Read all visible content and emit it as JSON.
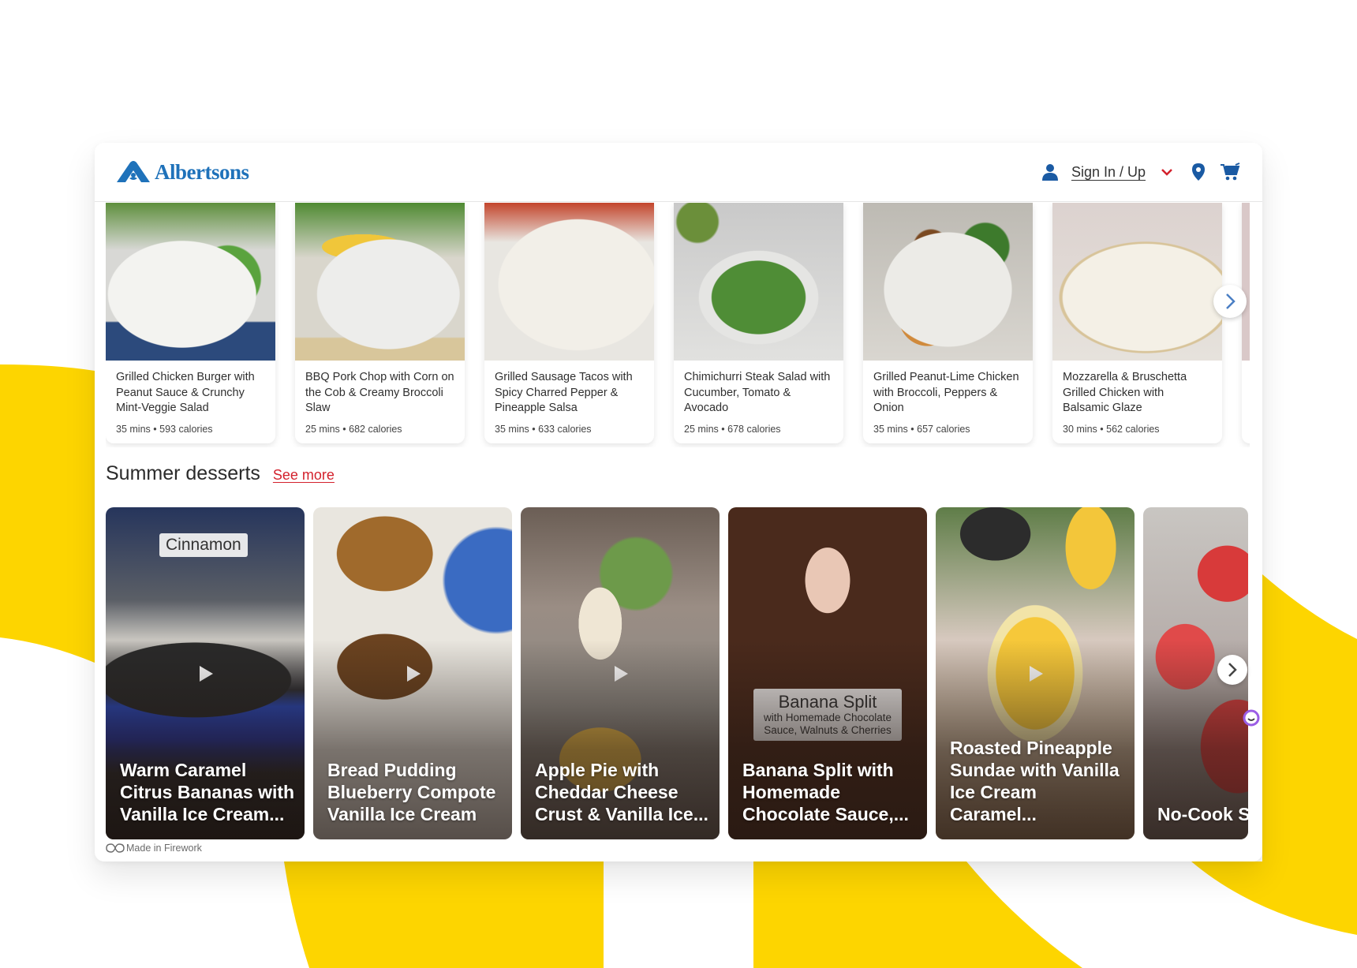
{
  "brand": {
    "name": "Albertsons",
    "primary_color": "#1f72ba",
    "accent_color": "#d3212c",
    "background_accent": "#fdd500"
  },
  "header": {
    "logo_icon": "albertsons-logo-icon",
    "user_icon": "user-icon",
    "sign_in_label": "Sign In / Up",
    "dropdown_icon": "chevron-down-icon",
    "location_icon": "location-pin-icon",
    "cart_icon": "cart-icon"
  },
  "recipes": [
    {
      "title": "Grilled Chicken Burger with Peanut Sauce & Crunchy Mint-Veggie Salad",
      "time": "35 mins",
      "calories": "593 calories"
    },
    {
      "title": "BBQ Pork Chop with Corn on the Cob & Creamy Broccoli Slaw",
      "time": "25 mins",
      "calories": "682 calories"
    },
    {
      "title": "Grilled Sausage Tacos with Spicy Charred Pepper & Pineapple Salsa",
      "time": "35 mins",
      "calories": "633 calories"
    },
    {
      "title": "Chimichurri Steak Salad with Cucumber, Tomato & Avocado",
      "time": "25 mins",
      "calories": "678 calories"
    },
    {
      "title": "Grilled Peanut-Lime Chicken with Broccoli, Peppers & Onion",
      "time": "35 mins",
      "calories": "657 calories"
    },
    {
      "title": "Mozzarella & Bruschetta Grilled Chicken with Balsamic Glaze",
      "time": "30 mins",
      "calories": "562 calories"
    }
  ],
  "meta_separator": "•",
  "desserts_section": {
    "title": "Summer desserts",
    "see_more_label": "See more",
    "videos": [
      {
        "title": "Warm Caramel Citrus Bananas with Vanilla Ice Cream...",
        "overlay": "Cinnamon"
      },
      {
        "title": "Bread Pudding Blueberry Compote Vanilla Ice Cream"
      },
      {
        "title": "Apple Pie with Cheddar Cheese Crust & Vanilla Ice..."
      },
      {
        "title": "Banana Split with Homemade Chocolate Sauce,...",
        "overlay_title": "Banana Split",
        "overlay_subtitle": "with Homemade Chocolate Sauce, Walnuts & Cherries"
      },
      {
        "title": "Roasted Pineapple Sundae with Vanilla Ice Cream Caramel..."
      },
      {
        "title": "No-Cook Strawberry Seed Fool"
      }
    ],
    "attribution": "Made in Firework"
  }
}
